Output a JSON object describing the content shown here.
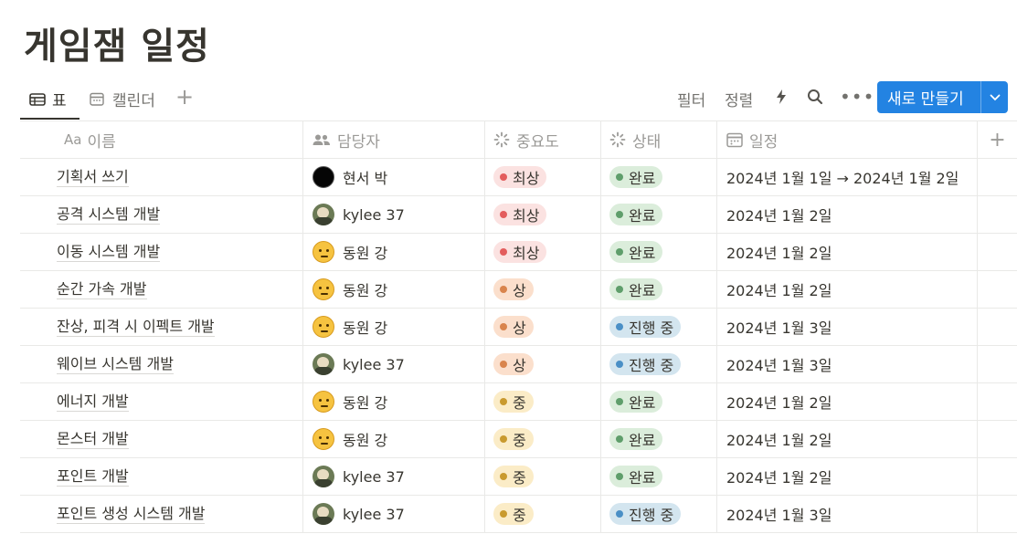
{
  "page": {
    "title": "게임잼 일정"
  },
  "views": {
    "tabs": [
      {
        "label": "표",
        "icon": "table-icon",
        "active": true
      },
      {
        "label": "캘린더",
        "icon": "calendar-icon",
        "active": false
      }
    ],
    "add_icon": "plus-icon"
  },
  "toolbar": {
    "filter_label": "필터",
    "sort_label": "정렬",
    "automation_icon": "bolt-icon",
    "search_icon": "search-icon",
    "more_icon": "more-icon",
    "new_label": "새로 만들기",
    "new_dropdown_icon": "chevron-down-icon"
  },
  "columns": {
    "name": {
      "prefix": "Aa",
      "label": "이름"
    },
    "owner": {
      "label": "담당자",
      "icon": "people-icon"
    },
    "importance": {
      "label": "중요도",
      "icon": "select-icon"
    },
    "status": {
      "label": "상태",
      "icon": "status-icon"
    },
    "date": {
      "label": "일정",
      "icon": "calendar-icon"
    }
  },
  "colors": {
    "accent": "#2383e2",
    "imp_top_bg": "#fbe2e1",
    "imp_top_dot": "#e35d5d",
    "imp_high_bg": "#fbdfcc",
    "imp_high_dot": "#d9844c",
    "imp_mid_bg": "#fbecc7",
    "imp_mid_dot": "#c99a2e",
    "status_done_bg": "#dbeddb",
    "status_done_dot": "#5f9e6b",
    "status_progress_bg": "#d3e5ef",
    "status_progress_dot": "#4a8fc6"
  },
  "rows": [
    {
      "name": "기획서 쓰기",
      "owner": "현서 박",
      "avatar": "black",
      "importance": "최상",
      "imp": "top",
      "status": "완료",
      "st": "done",
      "date": "2024년 1월 1일 → 2024년 1월 2일"
    },
    {
      "name": "공격 시스템 개발",
      "owner": "kylee 37",
      "avatar": "kylee",
      "importance": "최상",
      "imp": "top",
      "status": "완료",
      "st": "done",
      "date": "2024년 1월 2일"
    },
    {
      "name": "이동 시스템 개발",
      "owner": "동원 강",
      "avatar": "emoji",
      "importance": "최상",
      "imp": "top",
      "status": "완료",
      "st": "done",
      "date": "2024년 1월 2일"
    },
    {
      "name": "순간 가속 개발",
      "owner": "동원 강",
      "avatar": "emoji",
      "importance": "상",
      "imp": "high",
      "status": "완료",
      "st": "done",
      "date": "2024년 1월 2일"
    },
    {
      "name": "잔상, 피격 시 이펙트 개발",
      "owner": "동원 강",
      "avatar": "emoji",
      "importance": "상",
      "imp": "high",
      "status": "진행 중",
      "st": "progress",
      "date": "2024년 1월 3일"
    },
    {
      "name": "웨이브 시스템 개발",
      "owner": "kylee 37",
      "avatar": "kylee",
      "importance": "상",
      "imp": "high",
      "status": "진행 중",
      "st": "progress",
      "date": "2024년 1월 3일"
    },
    {
      "name": "에너지 개발",
      "owner": "동원 강",
      "avatar": "emoji",
      "importance": "중",
      "imp": "mid",
      "status": "완료",
      "st": "done",
      "date": "2024년 1월 2일"
    },
    {
      "name": "몬스터 개발",
      "owner": "동원 강",
      "avatar": "emoji",
      "importance": "중",
      "imp": "mid",
      "status": "완료",
      "st": "done",
      "date": "2024년 1월 2일"
    },
    {
      "name": "포인트 개발",
      "owner": "kylee 37",
      "avatar": "kylee",
      "importance": "중",
      "imp": "mid",
      "status": "완료",
      "st": "done",
      "date": "2024년 1월 2일"
    },
    {
      "name": "포인트 생성 시스템 개발",
      "owner": "kylee 37",
      "avatar": "kylee",
      "importance": "중",
      "imp": "mid",
      "status": "진행 중",
      "st": "progress",
      "date": "2024년 1월 3일"
    }
  ]
}
